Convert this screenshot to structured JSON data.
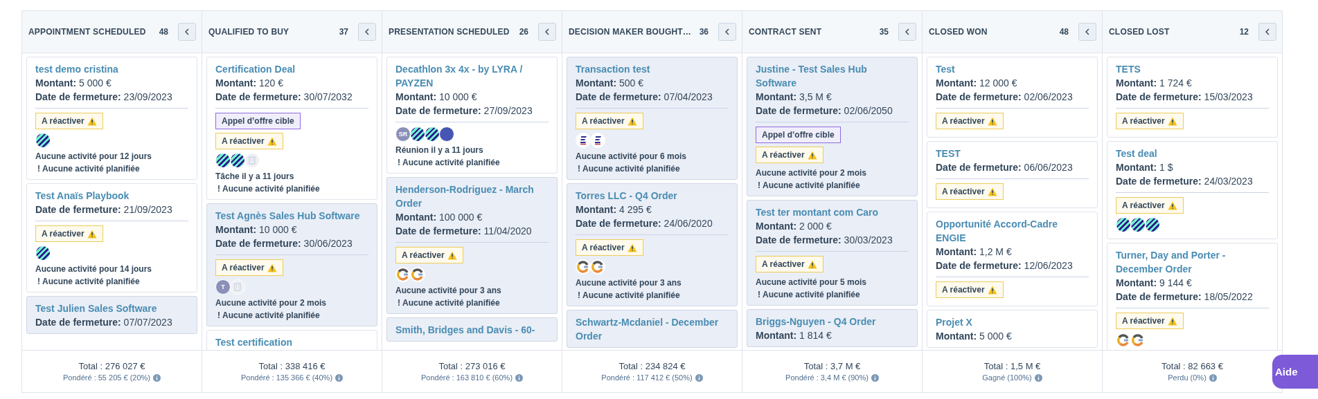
{
  "columns": [
    {
      "name": "APPOINTMENT SCHEDULED",
      "count": "48",
      "total": "Total : 276 027 €",
      "note": "Pondéré : 55 205 € (20%)",
      "cards": [
        {
          "title": "test demo cristina",
          "highlighted": false,
          "lines": [
            "**Montant:** 5 000 €",
            "**Date de fermeture:** 23/09/2023"
          ],
          "tags": [
            {
              "kind": "reactivate",
              "label": "A réactiver"
            }
          ],
          "avatars": [
            {
              "kind": "stripes"
            }
          ],
          "activity": "Aucune activité pour 12 jours",
          "next_mark": "!",
          "next": "Aucune activité planifiée"
        },
        {
          "title": "Test Anaïs Playbook",
          "highlighted": false,
          "lines": [
            "**Date de fermeture:** 21/09/2023"
          ],
          "tags": [
            {
              "kind": "reactivate",
              "label": "A réactiver"
            }
          ],
          "avatars": [
            {
              "kind": "stripes"
            }
          ],
          "activity": "Aucune activité pour 14 jours",
          "next_mark": "!",
          "next": "Aucune activité planifiée"
        },
        {
          "title": "Test Julien Sales Software",
          "highlighted": true,
          "lines": [
            "**Date de fermeture:** 07/07/2023"
          ]
        }
      ]
    },
    {
      "name": "QUALIFIED TO BUY",
      "count": "37",
      "total": "Total : 338 416 €",
      "note": "Pondéré : 135 366 € (40%)",
      "cards": [
        {
          "title": "Certification Deal",
          "highlighted": false,
          "lines": [
            "**Montant:** 120 €",
            "**Date de fermeture:** 30/07/2032"
          ],
          "tags": [
            {
              "kind": "target",
              "label": "Appel d’offre cible"
            },
            {
              "kind": "reactivate",
              "label": "A réactiver"
            }
          ],
          "avatars": [
            {
              "kind": "stripes"
            },
            {
              "kind": "stripes"
            },
            {
              "kind": "building"
            }
          ],
          "activity": "Tâche il y a 11 jours",
          "next_mark": "!",
          "next": "Aucune activité planifiée"
        },
        {
          "title": "Test Agnès Sales Hub Software",
          "highlighted": true,
          "lines": [
            "**Montant:** 10 000 €",
            "**Date de fermeture:** 30/06/2023"
          ],
          "tags": [
            {
              "kind": "reactivate",
              "label": "A réactiver"
            }
          ],
          "avatars": [
            {
              "kind": "initials",
              "initials": "T"
            },
            {
              "kind": "building"
            }
          ],
          "activity": "Aucune activité pour 2 mois",
          "next_mark": "!",
          "next": "Aucune activité planifiée"
        },
        {
          "title": "Test certification",
          "highlighted": false
        }
      ]
    },
    {
      "name": "PRESENTATION SCHEDULED",
      "count": "26",
      "total": "Total : 273 016 €",
      "note": "Pondéré : 163 810 € (60%)",
      "cards": [
        {
          "title": "Decathlon 3x 4x - by LYRA / PAYZEN",
          "highlighted": false,
          "lines": [
            "**Montant:** 10 000 €",
            "**Date de fermeture:** 27/09/2023"
          ],
          "avatars": [
            {
              "kind": "initials",
              "initials": "SR"
            },
            {
              "kind": "stripes"
            },
            {
              "kind": "stripes"
            },
            {
              "kind": "logo"
            }
          ],
          "activity": "Réunion il y a 11 jours",
          "next_mark": "!",
          "next": "Aucune activité planifiée"
        },
        {
          "title": "Henderson-Rodriguez - March Order",
          "highlighted": true,
          "lines": [
            "**Montant:** 100 000 €",
            "**Date de fermeture:** 11/04/2020"
          ],
          "tags": [
            {
              "kind": "reactivate",
              "label": "A réactiver"
            }
          ],
          "avatars": [
            {
              "kind": "ring"
            },
            {
              "kind": "ring"
            }
          ],
          "activity": "Aucune activité pour 3 ans",
          "next_mark": "!",
          "next": "Aucune activité planifiée"
        },
        {
          "title": "Smith, Bridges and Davis - 60-",
          "highlighted": true
        }
      ]
    },
    {
      "name": "DECISION MAKER BOUGHT…",
      "count": "36",
      "total": "Total : 234 824 €",
      "note": "Pondéré : 117 412 € (50%)",
      "cards": [
        {
          "title": "Transaction test",
          "highlighted": true,
          "lines": [
            "**Montant:** 500 €",
            "**Date de fermeture:** 07/04/2023"
          ],
          "tags": [
            {
              "kind": "reactivate",
              "label": "A réactiver"
            }
          ],
          "avatars": [
            {
              "kind": "bars"
            },
            {
              "kind": "bars"
            }
          ],
          "activity": "Aucune activité pour 6 mois",
          "next_mark": "!",
          "next": "Aucune activité planifiée"
        },
        {
          "title": "Torres LLC - Q4 Order",
          "highlighted": true,
          "lines": [
            "**Montant:** 4 295 €",
            "**Date de fermeture:** 24/06/2020"
          ],
          "tags": [
            {
              "kind": "reactivate",
              "label": "A réactiver"
            }
          ],
          "avatars": [
            {
              "kind": "ring"
            },
            {
              "kind": "ring"
            }
          ],
          "activity": "Aucune activité pour 3 ans",
          "next_mark": "!",
          "next": "Aucune activité planifiée"
        },
        {
          "title": "Schwartz-Mcdaniel - December Order",
          "highlighted": true
        }
      ]
    },
    {
      "name": "CONTRACT SENT",
      "count": "35",
      "total": "Total : 3,7 M €",
      "note": "Pondéré : 3,4 M € (90%)",
      "cards": [
        {
          "title": "Justine - Test Sales Hub Software",
          "highlighted": true,
          "lines": [
            "**Montant:** 3,5 M €",
            "**Date de fermeture:** 02/06/2050"
          ],
          "tags": [
            {
              "kind": "target",
              "label": "Appel d’offre cible"
            },
            {
              "kind": "reactivate",
              "label": "A réactiver"
            }
          ],
          "activity": "Aucune activité pour 2 mois",
          "next_mark": "!",
          "next": "Aucune activité planifiée"
        },
        {
          "title": "Test ter montant com Caro",
          "highlighted": true,
          "lines": [
            "**Montant:** 2 000 €",
            "**Date de fermeture:** 30/03/2023"
          ],
          "tags": [
            {
              "kind": "reactivate",
              "label": "A réactiver"
            }
          ],
          "activity": "Aucune activité pour 5 mois",
          "next_mark": "!",
          "next": "Aucune activité planifiée"
        },
        {
          "title": "Briggs-Nguyen - Q4 Order",
          "highlighted": true,
          "lines": [
            "**Montant:** 1 814 €"
          ]
        }
      ]
    },
    {
      "name": "CLOSED WON",
      "count": "48",
      "total": "Total : 1,5 M €",
      "note": "Gagné (100%)",
      "cards": [
        {
          "title": "Test",
          "highlighted": false,
          "lines": [
            "**Montant:** 12 000 €",
            "**Date de fermeture:** 02/06/2023"
          ],
          "tags": [
            {
              "kind": "reactivate",
              "label": "A réactiver"
            }
          ]
        },
        {
          "title": "TEST",
          "highlighted": false,
          "lines": [
            "**Date de fermeture:** 06/06/2023"
          ],
          "tags": [
            {
              "kind": "reactivate",
              "label": "A réactiver"
            }
          ]
        },
        {
          "title": "Opportunité Accord-Cadre ENGIE",
          "highlighted": false,
          "lines": [
            "**Montant:** 1,2 M €",
            "**Date de fermeture:** 12/06/2023"
          ],
          "tags": [
            {
              "kind": "reactivate",
              "label": "A réactiver"
            }
          ]
        },
        {
          "title": "Projet X",
          "highlighted": false,
          "lines": [
            "**Montant:** 5 000 €"
          ]
        }
      ]
    },
    {
      "name": "CLOSED LOST",
      "count": "12",
      "total": "Total : 82 663 €",
      "note": "Perdu (0%)",
      "cards": [
        {
          "title": "TETS",
          "highlighted": false,
          "lines": [
            "**Montant:** 1 724 €",
            "**Date de fermeture:** 15/03/2023"
          ],
          "tags": [
            {
              "kind": "reactivate",
              "label": "A réactiver"
            }
          ]
        },
        {
          "title": "Test deal",
          "highlighted": false,
          "lines": [
            "**Montant:** 1 $",
            "**Date de fermeture:** 24/03/2023"
          ],
          "tags": [
            {
              "kind": "reactivate",
              "label": "A réactiver"
            }
          ],
          "avatars": [
            {
              "kind": "stripes"
            },
            {
              "kind": "stripes"
            },
            {
              "kind": "stripes"
            }
          ]
        },
        {
          "title": "Turner, Day and Porter - December Order",
          "highlighted": false,
          "lines": [
            "**Montant:** 9 144 €",
            "**Date de fermeture:** 18/05/2022"
          ],
          "tags": [
            {
              "kind": "reactivate",
              "label": "A réactiver"
            }
          ],
          "avatars": [
            {
              "kind": "ring"
            },
            {
              "kind": "ring"
            }
          ]
        }
      ]
    }
  ],
  "help_button": "Aide"
}
